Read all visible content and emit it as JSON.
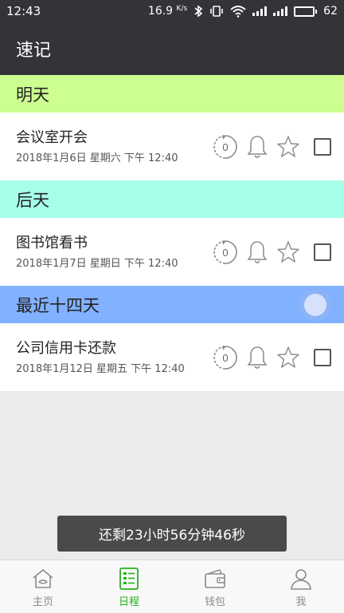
{
  "status_bar": {
    "time": "12:43",
    "net_speed": "16.9",
    "net_unit": "K/s",
    "battery": "62",
    "battery_level": 0.62,
    "icons": [
      "bluetooth-icon",
      "vibrate-icon",
      "wifi-icon",
      "signal-icon",
      "signal-4g-icon",
      "battery-icon"
    ]
  },
  "app_bar": {
    "title": "速记"
  },
  "groups": [
    {
      "header": "明天",
      "color": "#ccff90",
      "tasks": [
        {
          "title": "会议室开会",
          "date": "2018年1月6日 星期六 下午 12:40",
          "repeat_count": "0"
        }
      ]
    },
    {
      "header": "后天",
      "color": "#a7ffeb",
      "tasks": [
        {
          "title": "图书馆看书",
          "date": "2018年1月7日 星期日 下午 12:40",
          "repeat_count": "0"
        }
      ]
    },
    {
      "header": "最近十四天",
      "color": "#82b1ff",
      "tasks": [
        {
          "title": "公司信用卡还款",
          "date": "2018年1月12日 星期五 下午 12:40",
          "repeat_count": "0"
        }
      ]
    }
  ],
  "toast": {
    "text": "还剩23小时56分钟46秒"
  },
  "bottom_nav": {
    "items": [
      {
        "label": "主页",
        "icon": "home-icon",
        "active": false
      },
      {
        "label": "日程",
        "icon": "schedule-icon",
        "active": true
      },
      {
        "label": "钱包",
        "icon": "wallet-icon",
        "active": false
      },
      {
        "label": "我",
        "icon": "person-icon",
        "active": false
      }
    ],
    "active_color": "#25b01e",
    "inactive_color": "#8a8a8a"
  }
}
